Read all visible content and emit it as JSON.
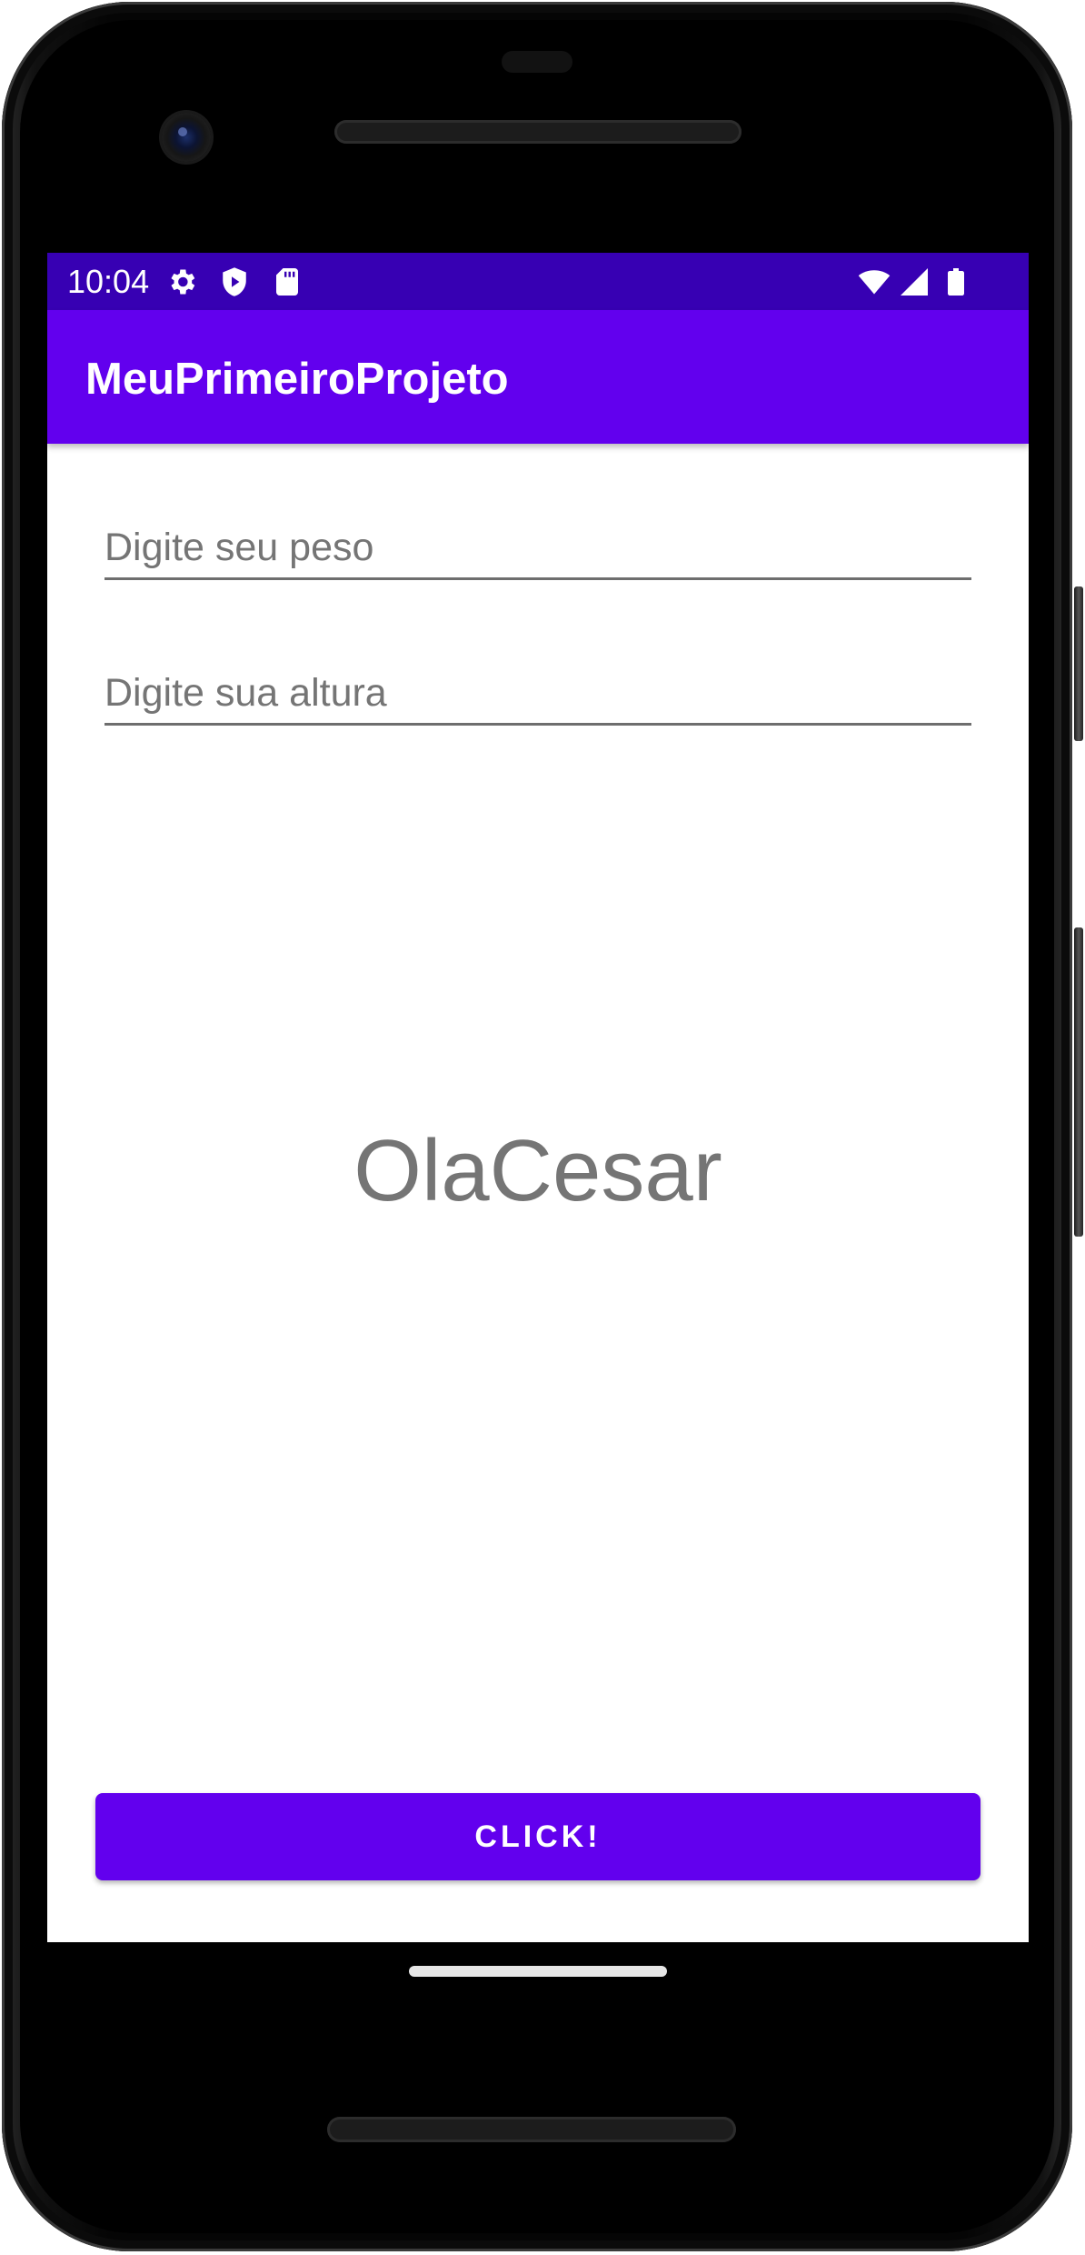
{
  "status_bar": {
    "time": "10:04",
    "left_icons": [
      "gear-icon",
      "shield-play-icon",
      "sd-card-icon"
    ],
    "right_icons": [
      "wifi-icon",
      "cell-signal-icon",
      "battery-icon"
    ],
    "color": "#3700b3"
  },
  "app_bar": {
    "title": "MeuPrimeiroProjeto",
    "color": "#6200ee"
  },
  "form": {
    "peso_placeholder": "Digite seu peso",
    "peso_value": "",
    "altura_placeholder": "Digite sua altura",
    "altura_value": ""
  },
  "result": {
    "text": "OlaCesar"
  },
  "button": {
    "label": "CLICK!",
    "color": "#6200ee"
  }
}
